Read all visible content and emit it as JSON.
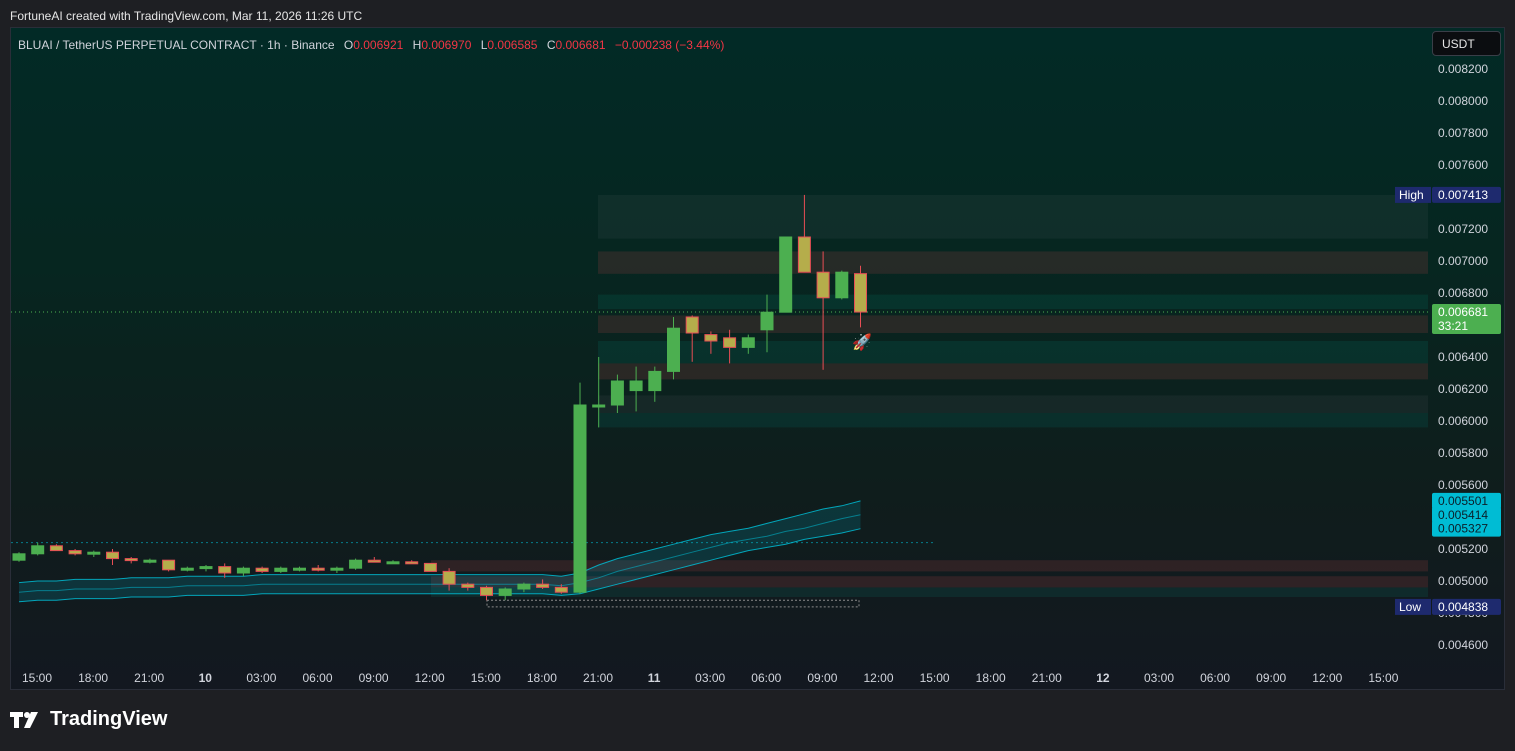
{
  "credit": "FortuneAI created with TradingView.com, Mar 11, 2026 11:26 UTC",
  "legend": {
    "symbol": "BLUAI / TetherUS PERPETUAL CONTRACT · 1h · Binance",
    "open_label": "O",
    "open": "0.006921",
    "high_label": "H",
    "high": "0.006970",
    "low_label": "L",
    "low": "0.006585",
    "close_label": "C",
    "close": "0.006681",
    "change": "−0.000238 (−3.44%)"
  },
  "currency": "USDT",
  "footer": {
    "brand": "TradingView"
  },
  "colors": {
    "up": "#4caf50",
    "down": "#e84e55",
    "accent": "#00bcd4",
    "high_tag": "#1e2a6e",
    "last_price": "#4caf50"
  },
  "chart_data": {
    "type": "candlestick",
    "interval": "1h",
    "ylim": [
      0.0045,
      0.0084
    ],
    "y_ticks": [
      "0.008200",
      "0.008000",
      "0.007800",
      "0.007600",
      "0.007400",
      "0.007200",
      "0.007000",
      "0.006800",
      "0.006600",
      "0.006400",
      "0.006200",
      "0.006000",
      "0.005800",
      "0.005600",
      "0.005400",
      "0.005200",
      "0.005000",
      "0.004800",
      "0.004600"
    ],
    "x_ticks": [
      "15:00",
      "18:00",
      "21:00",
      "10",
      "03:00",
      "06:00",
      "09:00",
      "12:00",
      "15:00",
      "18:00",
      "21:00",
      "11",
      "03:00",
      "06:00",
      "09:00",
      "12:00",
      "15:00",
      "18:00",
      "21:00",
      "12",
      "03:00",
      "06:00",
      "09:00",
      "12:00",
      "15:00"
    ],
    "bold_ticks": [
      "10",
      "11",
      "12"
    ],
    "candles": [
      [
        0.00513,
        0.00518,
        0.00512,
        0.00517
      ],
      [
        0.00517,
        0.00524,
        0.00516,
        0.00522
      ],
      [
        0.00522,
        0.00523,
        0.00519,
        0.00519
      ],
      [
        0.00519,
        0.0052,
        0.00516,
        0.00517
      ],
      [
        0.00517,
        0.00519,
        0.00515,
        0.00518
      ],
      [
        0.00518,
        0.0052,
        0.0051,
        0.00514
      ],
      [
        0.00514,
        0.00515,
        0.00511,
        0.00513
      ],
      [
        0.00513,
        0.00514,
        0.00511,
        0.00513
      ],
      [
        0.00513,
        0.00513,
        0.00506,
        0.00507
      ],
      [
        0.00507,
        0.00509,
        0.00506,
        0.00508
      ],
      [
        0.00508,
        0.0051,
        0.00506,
        0.00509
      ],
      [
        0.00509,
        0.00511,
        0.00502,
        0.00505
      ],
      [
        0.00505,
        0.00509,
        0.00503,
        0.00508
      ],
      [
        0.00508,
        0.00509,
        0.00505,
        0.00506
      ],
      [
        0.00506,
        0.00509,
        0.00505,
        0.00508
      ],
      [
        0.00508,
        0.00509,
        0.00506,
        0.00508
      ],
      [
        0.00508,
        0.0051,
        0.00506,
        0.00507
      ],
      [
        0.00507,
        0.00509,
        0.00505,
        0.00508
      ],
      [
        0.00508,
        0.00514,
        0.00507,
        0.00513
      ],
      [
        0.00513,
        0.00515,
        0.00512,
        0.00512
      ],
      [
        0.00512,
        0.00513,
        0.00511,
        0.00512
      ],
      [
        0.00512,
        0.00513,
        0.00511,
        0.00511
      ],
      [
        0.00511,
        0.00511,
        0.00506,
        0.00506
      ],
      [
        0.00506,
        0.00508,
        0.00494,
        0.00498
      ],
      [
        0.00498,
        0.00499,
        0.00494,
        0.00496
      ],
      [
        0.00496,
        0.00497,
        0.00488,
        0.00491
      ],
      [
        0.00491,
        0.00496,
        0.00488,
        0.00495
      ],
      [
        0.00495,
        0.00499,
        0.00493,
        0.00498
      ],
      [
        0.00498,
        0.00501,
        0.00495,
        0.00496
      ],
      [
        0.00496,
        0.00498,
        0.00492,
        0.00493
      ],
      [
        0.00493,
        0.00624,
        0.00492,
        0.0061
      ],
      [
        0.0061,
        0.0064,
        0.00596,
        0.0061
      ],
      [
        0.0061,
        0.00629,
        0.00605,
        0.00625
      ],
      [
        0.00619,
        0.00634,
        0.00606,
        0.00625
      ],
      [
        0.00619,
        0.00634,
        0.00612,
        0.00631
      ],
      [
        0.00631,
        0.00665,
        0.00626,
        0.00658
      ],
      [
        0.00665,
        0.00666,
        0.00637,
        0.00655
      ],
      [
        0.00654,
        0.00656,
        0.00642,
        0.0065
      ],
      [
        0.00652,
        0.00657,
        0.00636,
        0.00646
      ],
      [
        0.00646,
        0.00654,
        0.00642,
        0.00652
      ],
      [
        0.00657,
        0.00679,
        0.00643,
        0.00668
      ],
      [
        0.00668,
        0.00715,
        0.00668,
        0.00715
      ],
      [
        0.00715,
        0.007413,
        0.00693,
        0.00693
      ],
      [
        0.00693,
        0.00706,
        0.00632,
        0.00677
      ],
      [
        0.00677,
        0.00694,
        0.00676,
        0.00693
      ],
      [
        0.006921,
        0.00697,
        0.006585,
        0.006681
      ]
    ],
    "series": [
      {
        "name": "",
        "values": [
          0.00499,
          0.005,
          0.005,
          0.00501,
          0.00501,
          0.00501,
          0.00502,
          0.00502,
          0.00502,
          0.00503,
          0.00503,
          0.00503,
          0.00503,
          0.00504,
          0.00504,
          0.00504,
          0.00504,
          0.00504,
          0.00504,
          0.00504,
          0.00504,
          0.00504,
          0.00504,
          0.00504,
          0.00504,
          0.00504,
          0.00504,
          0.00504,
          0.00504,
          0.00503,
          0.00505,
          0.0051,
          0.00514,
          0.00517,
          0.0052,
          0.00523,
          0.00526,
          0.00529,
          0.00531,
          0.00533,
          0.00536,
          0.00539,
          0.00542,
          0.00545,
          0.00547,
          0.005501
        ]
      },
      {
        "name": "",
        "values": [
          0.00493,
          0.00494,
          0.00494,
          0.00495,
          0.00495,
          0.00495,
          0.00496,
          0.00496,
          0.00496,
          0.00497,
          0.00497,
          0.00497,
          0.00497,
          0.00498,
          0.00498,
          0.00498,
          0.00498,
          0.00498,
          0.00498,
          0.00498,
          0.00498,
          0.00498,
          0.00498,
          0.00498,
          0.00498,
          0.00498,
          0.00498,
          0.00498,
          0.00498,
          0.00497,
          0.00499,
          0.00502,
          0.00506,
          0.00509,
          0.00512,
          0.00515,
          0.00518,
          0.00521,
          0.00524,
          0.00526,
          0.00528,
          0.00531,
          0.00533,
          0.00536,
          0.00539,
          0.005414
        ]
      },
      {
        "name": "",
        "values": [
          0.00487,
          0.00488,
          0.00488,
          0.00489,
          0.00489,
          0.00489,
          0.0049,
          0.0049,
          0.0049,
          0.00491,
          0.00491,
          0.00491,
          0.00491,
          0.00492,
          0.00492,
          0.00492,
          0.00492,
          0.00492,
          0.00492,
          0.00492,
          0.00492,
          0.00492,
          0.00492,
          0.00492,
          0.00492,
          0.00492,
          0.00492,
          0.00492,
          0.00492,
          0.00491,
          0.00492,
          0.00495,
          0.00498,
          0.00501,
          0.00504,
          0.00507,
          0.0051,
          0.00513,
          0.00516,
          0.00519,
          0.00521,
          0.00523,
          0.00526,
          0.00528,
          0.0053,
          0.005327
        ]
      }
    ],
    "zones": [
      {
        "from": 0.007413,
        "to": 0.00714,
        "tone": "neutral"
      },
      {
        "from": 0.00706,
        "to": 0.00692,
        "tone": "bear"
      },
      {
        "from": 0.00679,
        "to": 0.0067,
        "tone": "bull"
      },
      {
        "from": 0.00666,
        "to": 0.00655,
        "tone": "bear"
      },
      {
        "from": 0.0065,
        "to": 0.00636,
        "tone": "bull"
      },
      {
        "from": 0.00636,
        "to": 0.00626,
        "tone": "bear"
      },
      {
        "from": 0.00616,
        "to": 0.00605,
        "tone": "neutral"
      },
      {
        "from": 0.00605,
        "to": 0.00596,
        "tone": "bull"
      },
      {
        "from": 0.00513,
        "to": 0.00506,
        "tone": "bear"
      },
      {
        "from": 0.00503,
        "to": 0.00496,
        "tone": "bear"
      },
      {
        "from": 0.00496,
        "to": 0.0049,
        "tone": "bull"
      }
    ],
    "price_labels": [
      {
        "text": "0.007413",
        "value": 0.007413,
        "tag": "High",
        "style": "high"
      },
      {
        "text": "0.006681",
        "value": 0.006681,
        "sub": "33:21",
        "style": "last"
      },
      {
        "text": "0.005501",
        "value": 0.005501,
        "style": "band"
      },
      {
        "text": "0.005414",
        "value": 0.005414,
        "style": "band"
      },
      {
        "text": "0.005327",
        "value": 0.005327,
        "style": "band"
      },
      {
        "text": "0.004838",
        "value": 0.004838,
        "tag": "Low",
        "style": "high"
      }
    ],
    "low_box": [
      0.004838,
      0.00488
    ],
    "dotted_level": 0.006681,
    "dashed_level": 0.00524
  }
}
